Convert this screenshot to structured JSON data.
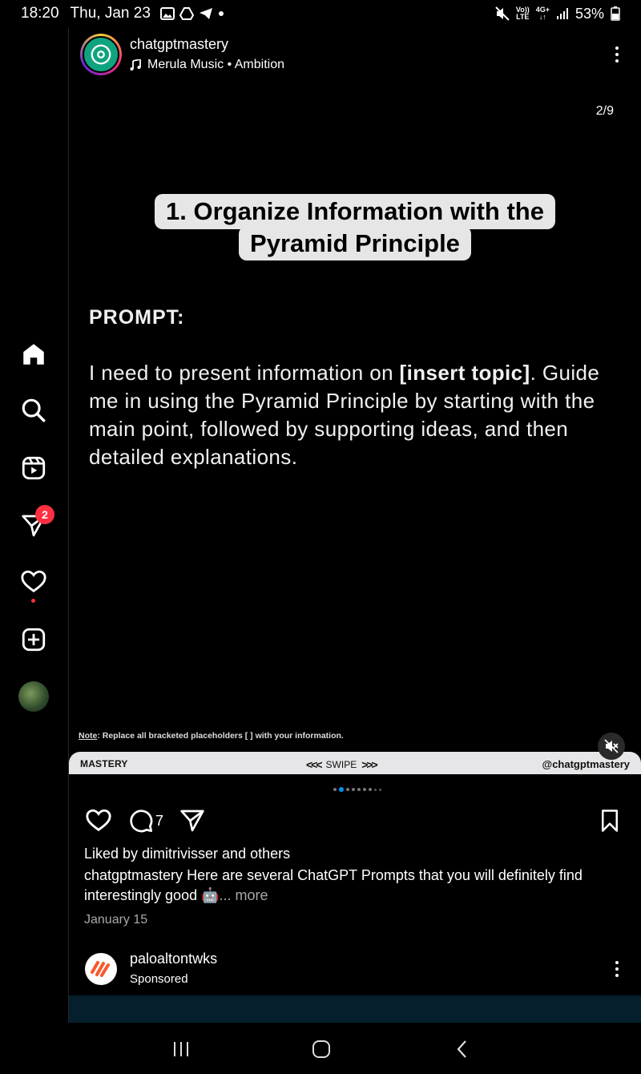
{
  "status_bar": {
    "time": "18:20",
    "date": "Thu, Jan 23",
    "network_top": "Vo))",
    "network_bottom": "LTE",
    "network2_top": "4G+",
    "network2_bottom": "↓↑",
    "battery": "53%"
  },
  "rail": {
    "messages_badge": "2"
  },
  "post": {
    "username": "chatgptmastery",
    "music": "Merula Music • Ambition",
    "slide_counter": "2/9",
    "title_line1": "1. Organize Information with the",
    "title_line2": "Pyramid Principle",
    "prompt_label": "PROMPT:",
    "prompt_pre": "I need to present information on ",
    "prompt_bold": "[insert topic]",
    "prompt_post": ". Guide me in using the Pyramid Principle by starting with the main point, followed by supporting ideas, and then detailed explanations.",
    "note_label": "Note",
    "note_text": ": Replace all bracketed placeholders [ ] with your information.",
    "band_left": "MASTERY",
    "band_swipe": "SWIPE",
    "band_chev_left": "<<<",
    "band_chev_right": ">>>",
    "band_right": "@chatgptmastery",
    "comment_count": "7",
    "likes": "Liked by dimitrivisser and others",
    "caption_user": "chatgptmastery",
    "caption_text": " Here are several ChatGPT Prompts that you will definitely find interestingly good 🤖",
    "caption_more": "... more",
    "date": "January 15"
  },
  "next_post": {
    "username": "paloaltontwks",
    "label": "Sponsored"
  }
}
